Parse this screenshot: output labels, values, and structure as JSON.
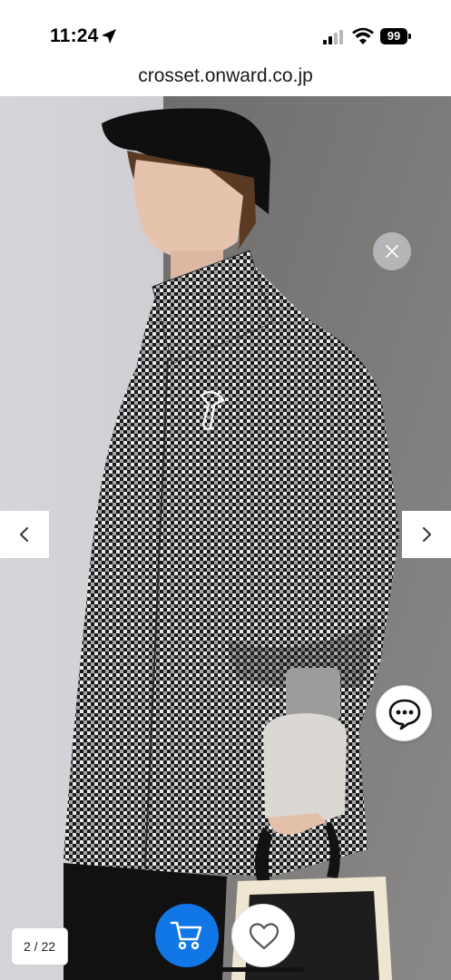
{
  "status_bar": {
    "time": "11:24",
    "battery_level": "99",
    "location_icon": "location-arrow-icon",
    "signal_icon": "cellular-signal-icon",
    "wifi_icon": "wifi-icon"
  },
  "browser": {
    "url": "crosset.onward.co.jp"
  },
  "gallery": {
    "image_counter": "2 / 22",
    "close_icon": "close-icon",
    "prev_icon": "chevron-left-icon",
    "next_icon": "chevron-right-icon",
    "chat_icon": "chat-bubble-icon",
    "cart_icon": "cart-icon",
    "favorite_icon": "heart-icon"
  },
  "colors": {
    "cart_button": "#1177e6",
    "close_button": "#c8c8cd"
  }
}
